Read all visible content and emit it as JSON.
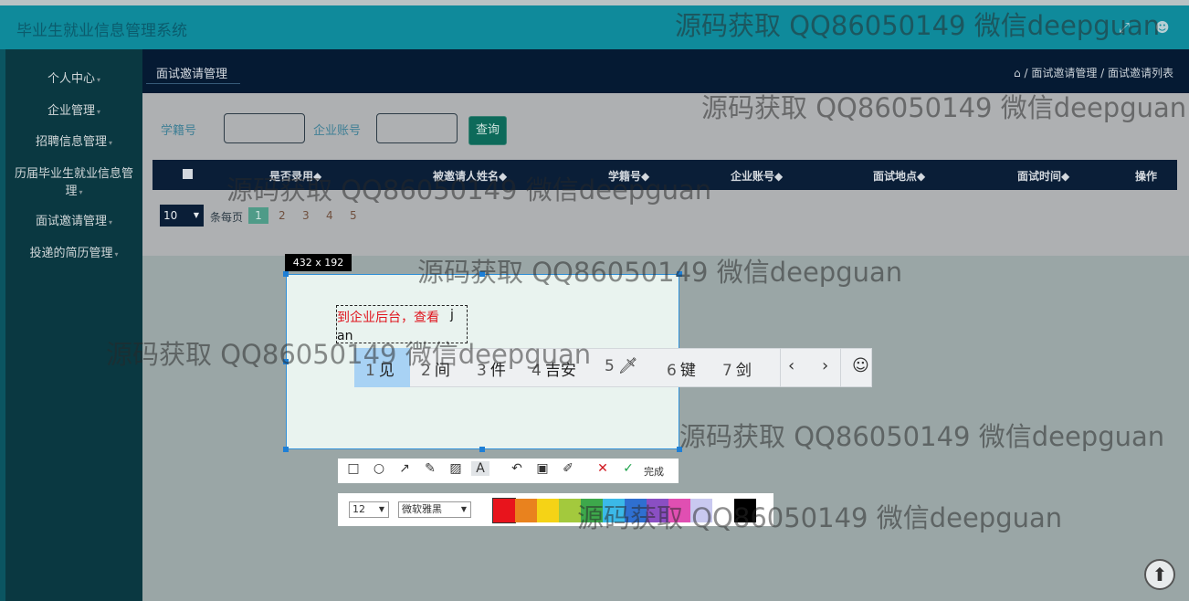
{
  "app": {
    "title": "毕业生就业信息管理系统"
  },
  "sidebar": {
    "items": [
      {
        "label": "个人中心"
      },
      {
        "label": "企业管理"
      },
      {
        "label": "招聘信息管理"
      },
      {
        "label": "历届毕业生就业信息管理"
      },
      {
        "label": "面试邀请管理"
      },
      {
        "label": "投递的简历管理"
      }
    ]
  },
  "breadcrumb": {
    "tab": "面试邀请管理",
    "path": "/ 面试邀请管理 / 面试邀请列表"
  },
  "search": {
    "student_id_label": "学籍号",
    "company_account_label": "企业账号",
    "query_button": "查询"
  },
  "table": {
    "columns": [
      "是否录用",
      "被邀请人姓名",
      "学籍号",
      "企业账号",
      "面试地点",
      "面试时间",
      "操作"
    ],
    "sort_mark": "◆"
  },
  "pagination": {
    "page_size": "10",
    "per_page_label": "条每页",
    "pages": [
      "1",
      "2",
      "3",
      "4",
      "5"
    ]
  },
  "capture": {
    "size_label": "432 x 192",
    "typed_text": "到企业后台，查看",
    "cursor_char": "j",
    "pinyin": "an",
    "ime_candidates": [
      {
        "num": "1",
        "text": "见"
      },
      {
        "num": "2",
        "text": "间"
      },
      {
        "num": "3",
        "text": "件"
      },
      {
        "num": "4",
        "text": "吉安"
      },
      {
        "num": "5",
        "text": "🗡"
      },
      {
        "num": "6",
        "text": "键"
      },
      {
        "num": "7",
        "text": "剑"
      }
    ],
    "done_label": "完成",
    "font_size": "12",
    "font_name": "微软雅黑",
    "colors": [
      "#e8141c",
      "#e9821e",
      "#f5d316",
      "#a3c93d",
      "#3da84b",
      "#3bb9e8",
      "#2f6fd0",
      "#8a4fc3",
      "#e04fb2",
      "#c9c9f0",
      "#ffffff",
      "#000000"
    ]
  },
  "watermark": "源码获取 QQ86050149 微信deepguan"
}
